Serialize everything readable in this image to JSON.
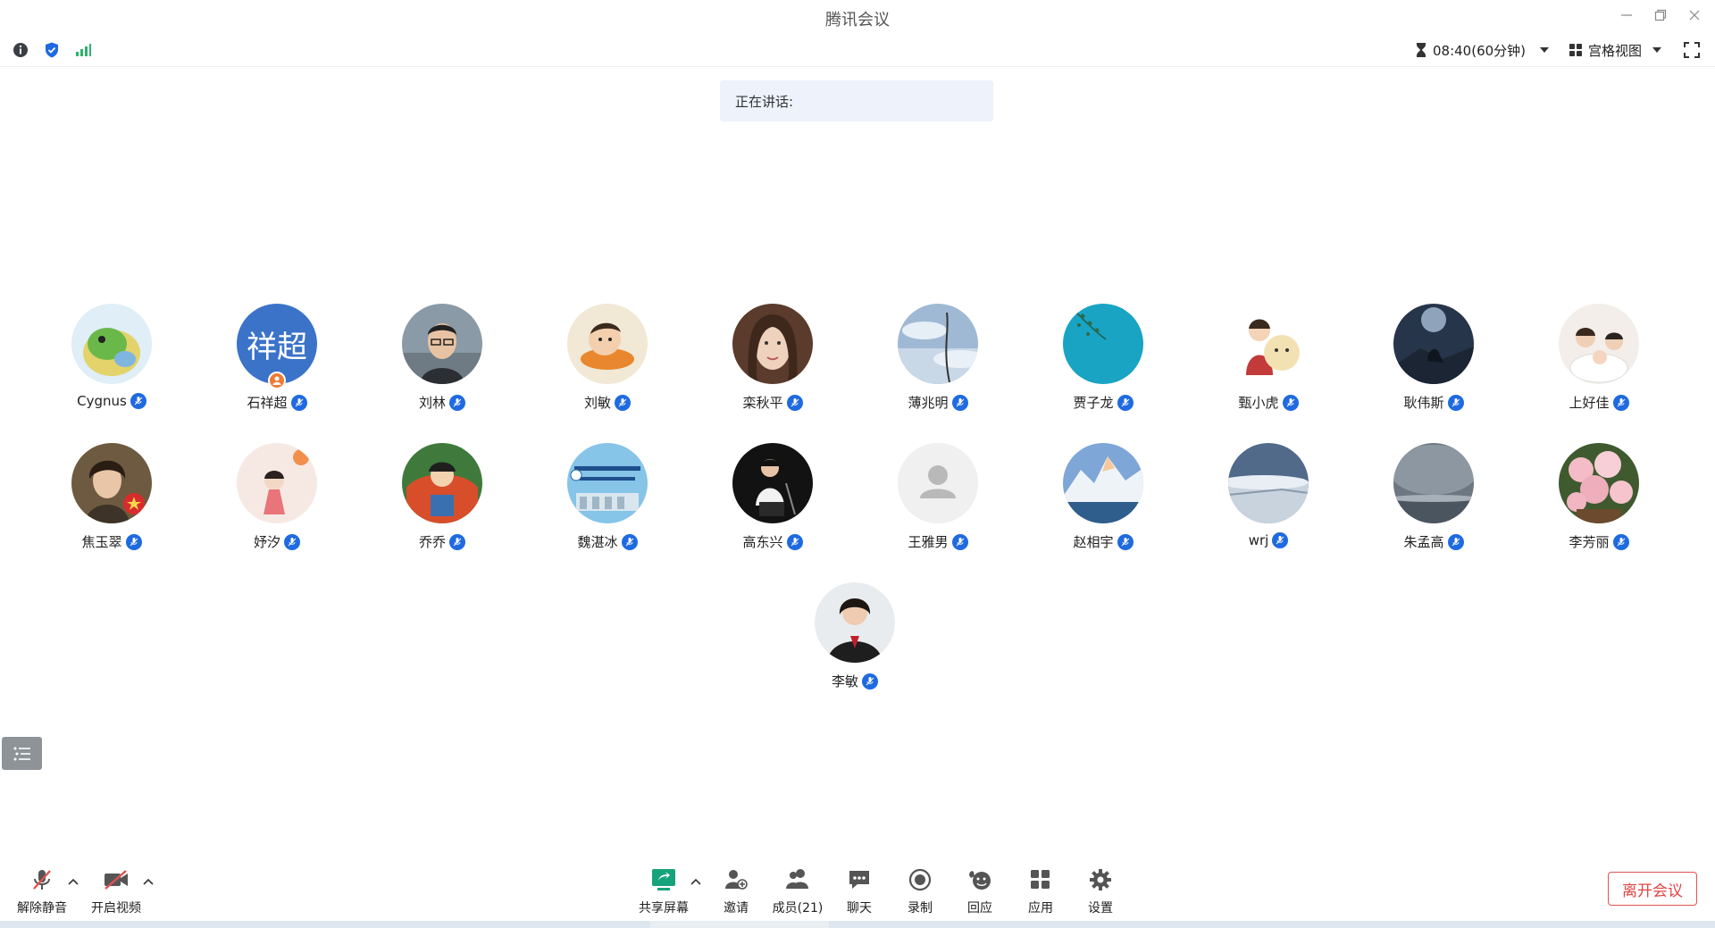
{
  "window": {
    "title": "腾讯会议",
    "controls": [
      "minimize-icon",
      "restore-icon",
      "close-icon"
    ]
  },
  "status_bar": {
    "icons": [
      "info-icon",
      "security-shield-icon",
      "signal-icon"
    ],
    "timer": "08:40(60分钟)",
    "view_mode": "宫格视图"
  },
  "speaking": {
    "label": "正在讲话:"
  },
  "participants": [
    {
      "name": "Cygnus",
      "avatar": "photo"
    },
    {
      "name": "石祥超",
      "avatar": "text",
      "avatar_text": "祥超",
      "host": true
    },
    {
      "name": "刘林",
      "avatar": "photo"
    },
    {
      "name": "刘敏",
      "avatar": "photo"
    },
    {
      "name": "栾秋平",
      "avatar": "photo"
    },
    {
      "name": "薄兆明",
      "avatar": "photo"
    },
    {
      "name": "贾子龙",
      "avatar": "photo"
    },
    {
      "name": "甄小虎",
      "avatar": "photo"
    },
    {
      "name": "耿伟斯",
      "avatar": "photo"
    },
    {
      "name": "上好佳",
      "avatar": "photo"
    },
    {
      "name": "焦玉翠",
      "avatar": "photo"
    },
    {
      "name": "妤汐",
      "avatar": "photo"
    },
    {
      "name": "乔乔",
      "avatar": "photo"
    },
    {
      "name": "魏湛冰",
      "avatar": "photo"
    },
    {
      "name": "高东兴",
      "avatar": "photo"
    },
    {
      "name": "王雅男",
      "avatar": "default"
    },
    {
      "name": "赵相宇",
      "avatar": "photo"
    },
    {
      "name": "wrj",
      "avatar": "photo"
    },
    {
      "name": "朱孟高",
      "avatar": "photo"
    },
    {
      "name": "李芳丽",
      "avatar": "photo"
    },
    {
      "name": "李敏",
      "avatar": "photo"
    }
  ],
  "colors": {
    "accent": "#1f6ae0",
    "leave": "#e04545",
    "share": "#16a37b",
    "muted": "#e05252"
  },
  "toolbar": {
    "unmute": "解除静音",
    "start_video": "开启视频",
    "share_screen": "共享屏幕",
    "invite": "邀请",
    "members": "成员(21)",
    "chat": "聊天",
    "record": "录制",
    "react": "回应",
    "apps": "应用",
    "settings": "设置",
    "leave": "离开会议"
  }
}
